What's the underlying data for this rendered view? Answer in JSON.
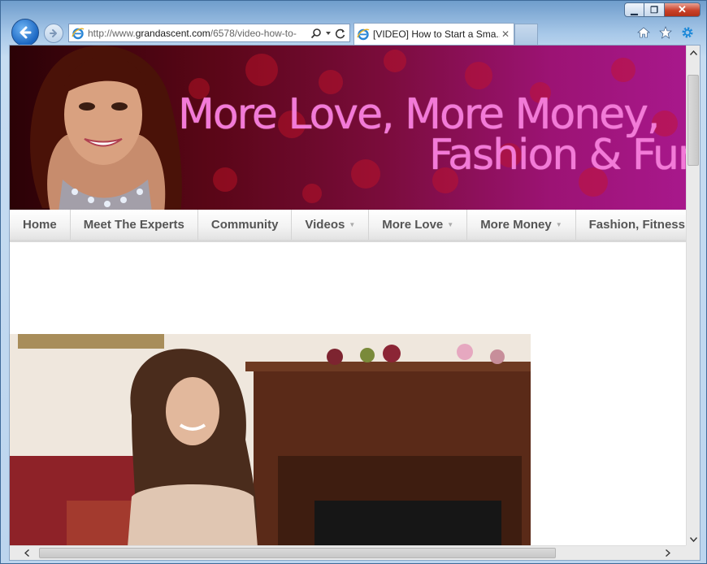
{
  "browser": {
    "address_prefix": "http://www.",
    "address_domain": "grandascent.com",
    "address_path": "/6578/video-how-to-",
    "tab_title": "[VIDEO] How to Start a Sma...",
    "tab_close": "✕",
    "caption": {
      "minimize": "▁",
      "maximize": "❐",
      "close": "✕"
    }
  },
  "banner": {
    "line1": "More Love, More Money,",
    "line2": "Fashion & Fun!"
  },
  "nav": {
    "items": [
      {
        "label": "Home",
        "has_caret": false
      },
      {
        "label": "Meet The Experts",
        "has_caret": false
      },
      {
        "label": "Community",
        "has_caret": false
      },
      {
        "label": "Videos",
        "has_caret": true
      },
      {
        "label": "More Love",
        "has_caret": true
      },
      {
        "label": "More Money",
        "has_caret": true
      },
      {
        "label": "Fashion, Fitness",
        "has_caret": false
      }
    ]
  },
  "colors": {
    "tagline": "#f37ad8",
    "nav_text": "#555555",
    "banner_dark": "#2b0206",
    "banner_magenta": "#a8188c"
  },
  "icons": {
    "back": "back-arrow-icon",
    "forward": "forward-arrow-icon",
    "search": "search-icon",
    "dropdown": "chevron-down-icon",
    "refresh": "refresh-icon",
    "home": "home-icon",
    "favorites": "star-icon",
    "tools": "gear-icon"
  }
}
